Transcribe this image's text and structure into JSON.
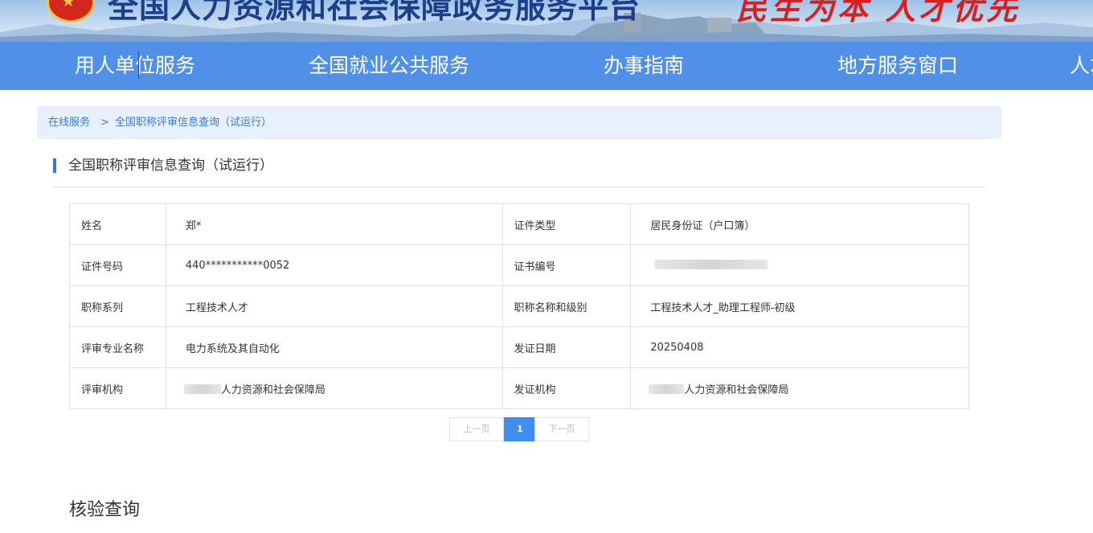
{
  "header": {
    "site_title": "全国人力资源和社会保障政务服务平台",
    "slogan": "民生为本 人才优先",
    "emblem_glyph": "★",
    "colors": {
      "nav_bg": "#5190e8",
      "title": "#1d3f8a",
      "slogan": "#d81f1f"
    }
  },
  "nav": {
    "items": [
      {
        "label": "用人单位服务"
      },
      {
        "label": "全国就业公共服务"
      },
      {
        "label": "办事指南"
      },
      {
        "label": "地方服务窗口"
      },
      {
        "label": "人才"
      }
    ]
  },
  "breadcrumb": {
    "home": "在线服务",
    "separator": ">",
    "current": "全国职称评审信息查询（试运行）"
  },
  "section": {
    "title": "全国职称评审信息查询（试运行）"
  },
  "record": {
    "name_label": "姓名",
    "name": "郑*",
    "id_type_label": "证件类型",
    "id_type": "居民身份证（户口簿）",
    "id_number_label": "证件号码",
    "id_number": "440***********0052",
    "cert_number_label": "证书编号",
    "cert_number": "",
    "title_series_label": "职称系列",
    "title_series": "工程技术人才",
    "title_level_label": "职称名称和级别",
    "title_level": "工程技术人才_助理工程师-初级",
    "major_label": "评审专业名称",
    "major": "电力系统及其自动化",
    "issue_date_label": "发证日期",
    "issue_date": "20250408",
    "review_org_label": "评审机构",
    "review_org_suffix": "人力资源和社会保障局",
    "issue_org_label": "发证机构",
    "issue_org_suffix": "人力资源和社会保障局"
  },
  "pagination": {
    "prev": "上一页",
    "current": "1",
    "next": "下一页"
  },
  "verify": {
    "title": "核验查询"
  }
}
